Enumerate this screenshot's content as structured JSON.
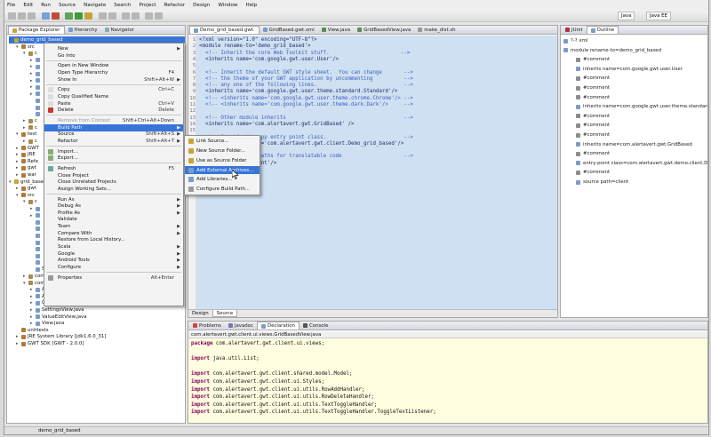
{
  "menubar": [
    "File",
    "Edit",
    "Run",
    "Source",
    "Navigate",
    "Search",
    "Project",
    "Refactor",
    "Design",
    "Window",
    "Help"
  ],
  "perspectives": [
    "Java",
    "Java EE"
  ],
  "explorer": {
    "tabs": [
      "Package Explorer",
      "Hierarchy",
      "Navigator"
    ],
    "rows": [
      {
        "label": "demo_grid_based",
        "depth": 0,
        "twisty": "▾",
        "sel": true
      },
      {
        "label": "src",
        "depth": 1,
        "twisty": "▾"
      },
      {
        "label": "c",
        "depth": 2,
        "twisty": "▾"
      },
      {
        "label": "",
        "depth": 3,
        "twisty": "▸"
      },
      {
        "label": "",
        "depth": 3,
        "twisty": "▸"
      },
      {
        "label": "",
        "depth": 3,
        "twisty": "▸"
      },
      {
        "label": "",
        "depth": 3,
        "twisty": "▸"
      },
      {
        "label": "",
        "depth": 3,
        "twisty": "▸"
      },
      {
        "label": "",
        "depth": 3,
        "twisty": "▸"
      },
      {
        "label": "",
        "depth": 3,
        "twisty": ""
      },
      {
        "label": "",
        "depth": 3,
        "twisty": ""
      },
      {
        "label": "",
        "depth": 3,
        "twisty": ""
      },
      {
        "label": "c",
        "depth": 2,
        "twisty": "▸"
      },
      {
        "label": "c",
        "depth": 2,
        "twisty": "▸"
      },
      {
        "label": "test",
        "depth": 1,
        "twisty": "▾"
      },
      {
        "label": "c",
        "depth": 2,
        "twisty": "▸"
      },
      {
        "label": "GWT",
        "depth": 1,
        "twisty": "▸"
      },
      {
        "label": "JRE",
        "depth": 1,
        "twisty": "▸"
      },
      {
        "label": "Refe",
        "depth": 1,
        "twisty": "▸"
      },
      {
        "label": "gwt",
        "depth": 1,
        "twisty": "▸"
      },
      {
        "label": "war",
        "depth": 1,
        "twisty": "▸"
      },
      {
        "label": "grid_base",
        "depth": 0,
        "twisty": "▾"
      },
      {
        "label": "gwt",
        "depth": 1,
        "twisty": "▸"
      },
      {
        "label": "src",
        "depth": 1,
        "twisty": "▾"
      },
      {
        "label": "c",
        "depth": 2,
        "twisty": "▾"
      },
      {
        "label": "",
        "depth": 3,
        "twisty": "▸"
      },
      {
        "label": "",
        "depth": 3,
        "twisty": "▸"
      },
      {
        "label": "",
        "depth": 3,
        "twisty": ""
      },
      {
        "label": "",
        "depth": 3,
        "twisty": ""
      },
      {
        "label": "",
        "depth": 3,
        "twisty": ""
      },
      {
        "label": "",
        "depth": 3,
        "twisty": ""
      },
      {
        "label": "",
        "depth": 3,
        "twisty": ""
      },
      {
        "label": "",
        "depth": 3,
        "twisty": ""
      },
      {
        "label": "",
        "depth": 3,
        "twisty": ""
      },
      {
        "label": "Styles.java",
        "depth": 3,
        "twisty": ""
      },
      {
        "label": "com.alertavert.gwt.client.ui.utils",
        "depth": 2,
        "twisty": "▸"
      },
      {
        "label": "com.alertavert.gwt.client.ui.views",
        "depth": 2,
        "twisty": "▾"
      },
      {
        "label": "ActionsView.java",
        "depth": 3,
        "twisty": "▸"
      },
      {
        "label": "AlertableOnActivationView.java",
        "depth": 3,
        "twisty": "▸"
      },
      {
        "label": "GridBasedView.java",
        "depth": 3,
        "twisty": "▸"
      },
      {
        "label": "SettingsView.java",
        "depth": 3,
        "twisty": "▸"
      },
      {
        "label": "ValueEditView.java",
        "depth": 3,
        "twisty": "▸"
      },
      {
        "label": "View.java",
        "depth": 3,
        "twisty": "▸"
      },
      {
        "label": "unittests",
        "depth": 1,
        "twisty": ""
      },
      {
        "label": "JRE System Library [jdk1.6.0_31]",
        "depth": 1,
        "twisty": "▸"
      },
      {
        "label": "GWT SDK [GWT - 2.0.0]",
        "depth": 1,
        "twisty": "▸"
      }
    ]
  },
  "editor": {
    "tabs": [
      "Demo_grid_based.gwt.",
      "GridBased.gwt.xml",
      "View.java",
      "GridBasedView.java",
      "make_dist.sh"
    ],
    "lines": [
      {
        "n": "1",
        "t": "<?xml version=\"1.0\" encoding=\"UTF-8\"?>",
        "cm": false
      },
      {
        "n": "2",
        "t": "<module rename-to='demo_grid_based'>",
        "cm": false
      },
      {
        "n": "3",
        "t": "  <!-- Inherit the core Web Toolkit stuff.                       -->",
        "cm": true
      },
      {
        "n": "4",
        "t": "  <inherits name='com.google.gwt.user.User'/>",
        "cm": false
      },
      {
        "n": "5",
        "t": "",
        "cm": false
      },
      {
        "n": "6",
        "t": "  <!-- Inherit the default GWT style sheet.  You can change       -->",
        "cm": true
      },
      {
        "n": "7",
        "t": "  <!-- the theme of your GWT application by uncommenting          -->",
        "cm": true
      },
      {
        "n": "8",
        "t": "  <!-- any one of the following lines.                            -->",
        "cm": true
      },
      {
        "n": "9",
        "t": "  <inherits name='com.google.gwt.user.theme.standard.Standard'/>",
        "cm": false
      },
      {
        "n": "10",
        "t": "  <!-- <inherits name='com.google.gwt.user.theme.chrome.Chrome'/> -->",
        "cm": true
      },
      {
        "n": "11",
        "t": "  <!-- <inherits name='com.google.gwt.user.theme.dark.Dark'/>     -->",
        "cm": true
      },
      {
        "n": "12",
        "t": "",
        "cm": false
      },
      {
        "n": "13",
        "t": "  <!-- Other module inherits                                      -->",
        "cm": true
      },
      {
        "n": "14",
        "t": "  <inherits name='com.alertavert.gwt.GridBased' />",
        "cm": false
      },
      {
        "n": "15",
        "t": "",
        "cm": false
      },
      {
        "n": "16",
        "t": "  <!-- Specify the app entry point class.                         -->",
        "cm": true
      },
      {
        "n": "17",
        "t": "  <entry-point class='com.alertavert.gwt.client.Demo_grid_based'/>",
        "cm": false
      },
      {
        "n": "18",
        "t": "",
        "cm": false
      },
      {
        "n": "19",
        "t": "  <!-- Specify the paths for translatable code                    -->",
        "cm": true
      },
      {
        "n": "20",
        "t": "  <source path='client'/>",
        "cm": false
      },
      {
        "n": "21",
        "t": "",
        "cm": false
      },
      {
        "n": "22",
        "t": "</module>",
        "cm": false
      },
      {
        "n": "23",
        "t": "",
        "cm": false
      }
    ],
    "bottom_tabs": [
      "Design",
      "Source"
    ]
  },
  "outline": {
    "tabs": [
      "JUnit",
      "Outline"
    ],
    "items": [
      {
        "label": "?-? xml",
        "depth": 0,
        "cm": false
      },
      {
        "label": "module rename-to=demo_grid_based",
        "depth": 0,
        "cm": false
      },
      {
        "label": "#comment",
        "depth": 1,
        "cm": true
      },
      {
        "label": "inherits name=com.google.gwt.user.User",
        "depth": 1,
        "cm": false
      },
      {
        "label": "#comment",
        "depth": 1,
        "cm": true
      },
      {
        "label": "#comment",
        "depth": 1,
        "cm": true
      },
      {
        "label": "#comment",
        "depth": 1,
        "cm": true
      },
      {
        "label": "inherits name=com.google.gwt.user.theme.standard.St",
        "depth": 1,
        "cm": false
      },
      {
        "label": "#comment",
        "depth": 1,
        "cm": true
      },
      {
        "label": "#comment",
        "depth": 1,
        "cm": true
      },
      {
        "label": "#comment",
        "depth": 1,
        "cm": true
      },
      {
        "label": "inherits name=com.alertavert.gwt.GridBased",
        "depth": 1,
        "cm": false
      },
      {
        "label": "#comment",
        "depth": 1,
        "cm": true
      },
      {
        "label": "entry-point class=com.alertavert.gwt.demo.client.Dem",
        "depth": 1,
        "cm": false
      },
      {
        "label": "#comment",
        "depth": 1,
        "cm": true
      },
      {
        "label": "source path=client",
        "depth": 1,
        "cm": false
      }
    ]
  },
  "bottom": {
    "tabs": [
      "Problems",
      "Javadoc",
      "Declaration",
      "Console"
    ],
    "path": "com.alertavert.gwt.client.ui.views.GridBasedView.java",
    "lines": [
      {
        "k": "package",
        "r": " com.alertavert.gwt.client.ui.views;"
      },
      {
        "k": "",
        "r": ""
      },
      {
        "k": "import",
        "r": " java.util.List;"
      },
      {
        "k": "",
        "r": ""
      },
      {
        "k": "import",
        "r": " com.alertavert.gwt.client.shared.model.Model;"
      },
      {
        "k": "import",
        "r": " com.alertavert.gwt.client.ui.Styles;"
      },
      {
        "k": "import",
        "r": " com.alertavert.gwt.client.ui.utils.RowAddHandler;"
      },
      {
        "k": "import",
        "r": " com.alertavert.gwt.client.ui.utils.RowDeleteHandler;"
      },
      {
        "k": "import",
        "r": " com.alertavert.gwt.client.ui.utils.TextToggleHandler;"
      },
      {
        "k": "import",
        "r": " com.alertavert.gwt.client.ui.utils.TextToggleHandler.ToggleTextListener;"
      }
    ]
  },
  "context_menu": {
    "items": [
      {
        "label": "New",
        "acc": "",
        "arrow": true
      },
      {
        "label": "Go Into",
        "acc": "",
        "arrow": false
      },
      {
        "sep": true
      },
      {
        "label": "Open in New Window",
        "acc": "",
        "arrow": false
      },
      {
        "label": "Open Type Hierarchy",
        "acc": "F4",
        "arrow": false
      },
      {
        "label": "Show In",
        "acc": "Shift+Alt+W",
        "arrow": true
      },
      {
        "sep": true
      },
      {
        "label": "Copy",
        "acc": "Ctrl+C",
        "arrow": false
      },
      {
        "label": "Copy Qualified Name",
        "acc": "",
        "arrow": false
      },
      {
        "label": "Paste",
        "acc": "Ctrl+V",
        "arrow": false
      },
      {
        "label": "Delete",
        "acc": "Delete",
        "arrow": false
      },
      {
        "sep": true
      },
      {
        "label": "Remove from Context",
        "acc": "Shift+Ctrl+Alt+Down",
        "arrow": false,
        "dis": true
      },
      {
        "label": "Build Path",
        "acc": "",
        "arrow": true,
        "hl": true
      },
      {
        "label": "Source",
        "acc": "Shift+Alt+S",
        "arrow": true
      },
      {
        "label": "Refactor",
        "acc": "Shift+Alt+T",
        "arrow": true
      },
      {
        "sep": true
      },
      {
        "label": "Import...",
        "acc": "",
        "arrow": false
      },
      {
        "label": "Export...",
        "acc": "",
        "arrow": false
      },
      {
        "sep": true
      },
      {
        "label": "Refresh",
        "acc": "F5",
        "arrow": false
      },
      {
        "label": "Close Project",
        "acc": "",
        "arrow": false
      },
      {
        "label": "Close Unrelated Projects",
        "acc": "",
        "arrow": false
      },
      {
        "label": "Assign Working Sets...",
        "acc": "",
        "arrow": false
      },
      {
        "sep": true
      },
      {
        "label": "Run As",
        "acc": "",
        "arrow": true
      },
      {
        "label": "Debug As",
        "acc": "",
        "arrow": true
      },
      {
        "label": "Profile As",
        "acc": "",
        "arrow": true
      },
      {
        "label": "Validate",
        "acc": "",
        "arrow": false
      },
      {
        "label": "Team",
        "acc": "",
        "arrow": true
      },
      {
        "label": "Compare With",
        "acc": "",
        "arrow": true
      },
      {
        "label": "Restore from Local History...",
        "acc": "",
        "arrow": false
      },
      {
        "label": "Scala",
        "acc": "",
        "arrow": true
      },
      {
        "label": "Google",
        "acc": "",
        "arrow": true
      },
      {
        "label": "Android Tools",
        "acc": "",
        "arrow": true
      },
      {
        "label": "Configure",
        "acc": "",
        "arrow": true
      },
      {
        "sep": true
      },
      {
        "label": "Properties",
        "acc": "Alt+Enter",
        "arrow": false
      }
    ]
  },
  "submenu": {
    "items": [
      {
        "label": "Link Source...",
        "hl": false
      },
      {
        "label": "New Source Folder...",
        "hl": false
      },
      {
        "label": "Use as Source Folder",
        "hl": false
      },
      {
        "label": "Add External Archives...",
        "hl": true
      },
      {
        "label": "Add Libraries...",
        "hl": false
      },
      {
        "label": "Configure Build Path...",
        "hl": false
      }
    ]
  },
  "status": "demo_grid_based"
}
